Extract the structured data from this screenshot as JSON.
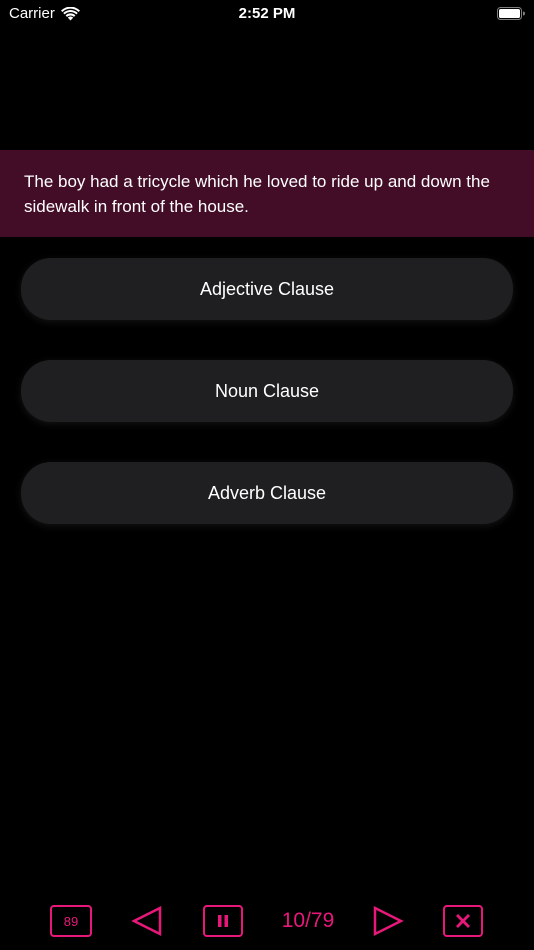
{
  "status_bar": {
    "carrier": "Carrier",
    "time": "2:52 PM"
  },
  "question": {
    "text": "The boy had a tricycle which he loved to ride up and down the sidewalk in front of the house."
  },
  "answers": [
    {
      "label": "Adjective Clause"
    },
    {
      "label": "Noun Clause"
    },
    {
      "label": "Adverb Clause"
    }
  ],
  "toolbar": {
    "count": "89",
    "progress": "10/79"
  },
  "colors": {
    "accent": "#e8187a",
    "banner": "#430d27",
    "answer_bg": "#1f1f21",
    "background": "#000000"
  }
}
